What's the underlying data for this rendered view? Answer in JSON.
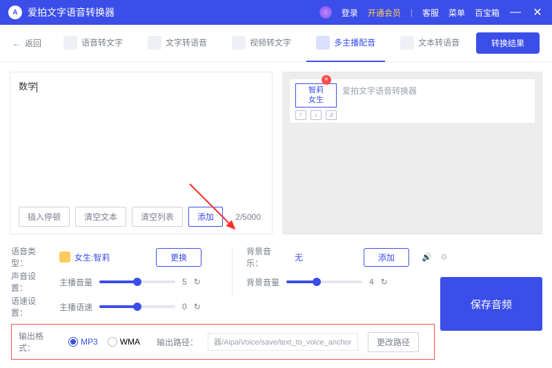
{
  "titlebar": {
    "app_name": "爱拍文字语音转换器",
    "login": "登录",
    "vip": "开通会员",
    "support": "客服",
    "menu": "菜单",
    "toolbox": "百宝箱"
  },
  "nav": {
    "back": "返回",
    "tabs": [
      "语音转文字",
      "文字转语音",
      "视频转文字",
      "多主播配音",
      "文本转语音"
    ],
    "active_index": 3,
    "result_btn": "转换结果"
  },
  "editor": {
    "text": "数学",
    "insert_pause": "插入停顿",
    "clear_text": "清空文本",
    "clear_list": "清空列表",
    "add": "添加",
    "count": "2/5000"
  },
  "anchor": {
    "name_line1": "智莉",
    "name_line2": "女生",
    "content": "爱拍文字语音转换器"
  },
  "settings": {
    "voice_type_label": "语音类型：",
    "voice_name": "女生:智莉",
    "change": "更换",
    "bgm_label": "背景音乐：",
    "bgm_value": "无",
    "bgm_add": "添加",
    "sound_label": "声音设置：",
    "vol_label": "主播音量",
    "vol_value": "5",
    "bgvol_label": "背景音量",
    "bgvol_value": "4",
    "speed_row_label": "语速设置：",
    "speed_label": "主播语速",
    "speed_value": "0",
    "output_label": "输出格式：",
    "fmt_mp3": "MP3",
    "fmt_wma": "WMA",
    "path_label": "输出路径：",
    "path_value": "器/AipaiVoice/save/text_to_voice_anchor",
    "change_path": "更改路径"
  },
  "save_btn": "保存音频"
}
